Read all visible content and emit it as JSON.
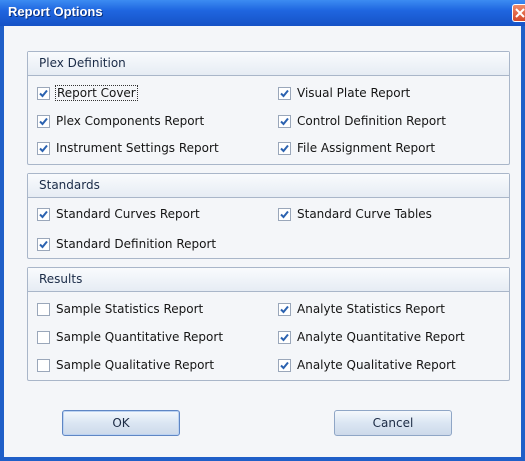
{
  "dialog": {
    "title": "Report Options",
    "colors": {
      "title_bar": "#1f66e0",
      "check": "#2b62b0",
      "group_border": "#a9b6c9"
    }
  },
  "groups": {
    "plex": {
      "title": "Plex Definition",
      "items": [
        {
          "label": "Report Cover",
          "checked": true
        },
        {
          "label": "Visual Plate Report",
          "checked": true
        },
        {
          "label": "Plex Components Report",
          "checked": true
        },
        {
          "label": "Control Definition Report",
          "checked": true
        },
        {
          "label": "Instrument Settings Report",
          "checked": true
        },
        {
          "label": "File Assignment Report",
          "checked": true
        }
      ]
    },
    "standards": {
      "title": "Standards",
      "items": [
        {
          "label": "Standard Curves Report",
          "checked": true
        },
        {
          "label": "Standard Curve Tables",
          "checked": true
        },
        {
          "label": "Standard Definition Report",
          "checked": true
        }
      ]
    },
    "results": {
      "title": "Results",
      "items": [
        {
          "label": "Sample Statistics Report",
          "checked": false
        },
        {
          "label": "Analyte Statistics Report",
          "checked": true
        },
        {
          "label": "Sample Quantitative Report",
          "checked": false
        },
        {
          "label": "Analyte Quantitative Report",
          "checked": true
        },
        {
          "label": "Sample Qualitative Report",
          "checked": false
        },
        {
          "label": "Analyte Qualitative Report",
          "checked": true
        }
      ]
    }
  },
  "buttons": {
    "ok": "OK",
    "cancel": "Cancel"
  }
}
